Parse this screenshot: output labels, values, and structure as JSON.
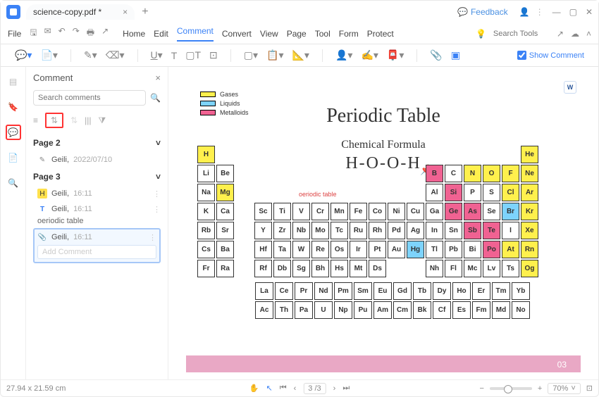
{
  "titlebar": {
    "filename": "science-copy.pdf *",
    "feedback": "Feedback"
  },
  "menubar": {
    "file": "File",
    "items": [
      "Home",
      "Edit",
      "Comment",
      "Convert",
      "View",
      "Page",
      "Tool",
      "Form",
      "Protect"
    ],
    "search_ph": "Search Tools"
  },
  "toolbar": {
    "show_comment": "Show Comment"
  },
  "panel": {
    "title": "Comment",
    "search_ph": "Search comments",
    "page2": "Page 2",
    "p2_user": "Geili,",
    "p2_date": "2022/07/10",
    "page3": "Page 3",
    "p3a_user": "Geili,",
    "p3a_time": "16:11",
    "p3b_user": "Geili,",
    "p3b_time": "16:11",
    "p3b_text": "oeriodic table",
    "p3c_user": "Geili,",
    "p3c_time": "16:11",
    "add_ph": "Add Comment"
  },
  "doc": {
    "legend": {
      "g": "Gases",
      "l": "Liquids",
      "m": "Metalloids"
    },
    "title": "Periodic Table",
    "subtitle": "Chemical Formula",
    "formula": "H-O-O-H",
    "annot": "oeriodic table",
    "page_no": "03"
  },
  "status": {
    "dims": "27.94 x 21.59 cm",
    "page": "3 /3",
    "zoom": "70%"
  },
  "chart_data": {
    "type": "table",
    "title": "Periodic Table",
    "legend": [
      {
        "label": "Gases",
        "color": "#fff04d"
      },
      {
        "label": "Liquids",
        "color": "#7dd3fc"
      },
      {
        "label": "Metalloids",
        "color": "#f06292"
      }
    ],
    "main_grid_rows": [
      [
        "H",
        "",
        "",
        "",
        "",
        "",
        "",
        "",
        "",
        "",
        "",
        "",
        "",
        "",
        "",
        "",
        "",
        "He"
      ],
      [
        "Li",
        "Be",
        "",
        "",
        "",
        "",
        "",
        "",
        "",
        "",
        "",
        "",
        "B",
        "C",
        "N",
        "O",
        "F",
        "Ne"
      ],
      [
        "Na",
        "Mg",
        "",
        "",
        "",
        "",
        "",
        "",
        "",
        "",
        "",
        "",
        "Al",
        "Si",
        "P",
        "S",
        "Cl",
        "Ar"
      ],
      [
        "K",
        "Ca",
        "",
        "Sc",
        "Ti",
        "V",
        "Cr",
        "Mn",
        "Fe",
        "Co",
        "Ni",
        "Cu",
        "Ga",
        "Ge",
        "As",
        "Se",
        "Br",
        "Kr"
      ],
      [
        "Rb",
        "Sr",
        "",
        "Y",
        "Zr",
        "Nb",
        "Mo",
        "Tc",
        "Ru",
        "Rh",
        "Pd",
        "Ag",
        "In",
        "Sn",
        "Sb",
        "Te",
        "I",
        "Xe"
      ],
      [
        "Cs",
        "Ba",
        "",
        "Hf",
        "Ta",
        "W",
        "Re",
        "Os",
        "Ir",
        "Pt",
        "Au",
        "Hg",
        "Tl",
        "Pb",
        "Bi",
        "Po",
        "At",
        "Rn"
      ],
      [
        "Fr",
        "Ra",
        "",
        "Rf",
        "Db",
        "Sg",
        "Bh",
        "Hs",
        "Mt",
        "Ds",
        "",
        "",
        "Nh",
        "Fl",
        "Mc",
        "Lv",
        "Ts",
        "Og"
      ]
    ],
    "highlight_yellow": [
      "H",
      "He",
      "Mg",
      "N",
      "O",
      "F",
      "Ne",
      "Cl",
      "Ar",
      "Kr",
      "Xe",
      "Rn",
      "Og",
      "Br",
      "At"
    ],
    "highlight_pink": [
      "B",
      "Si",
      "Ge",
      "As",
      "Sb",
      "Te",
      "Po"
    ],
    "highlight_blue": [
      "Hg",
      "Br"
    ],
    "lanthan_rows": [
      [
        "La",
        "Ce",
        "Pr",
        "Nd",
        "Pm",
        "Sm",
        "Eu",
        "Gd",
        "Tb",
        "Dy",
        "Ho",
        "Er",
        "Tm",
        "Yb"
      ],
      [
        "Ac",
        "Th",
        "Pa",
        "U",
        "Np",
        "Pu",
        "Am",
        "Cm",
        "Bk",
        "Cf",
        "Es",
        "Fm",
        "Md",
        "No"
      ]
    ]
  }
}
